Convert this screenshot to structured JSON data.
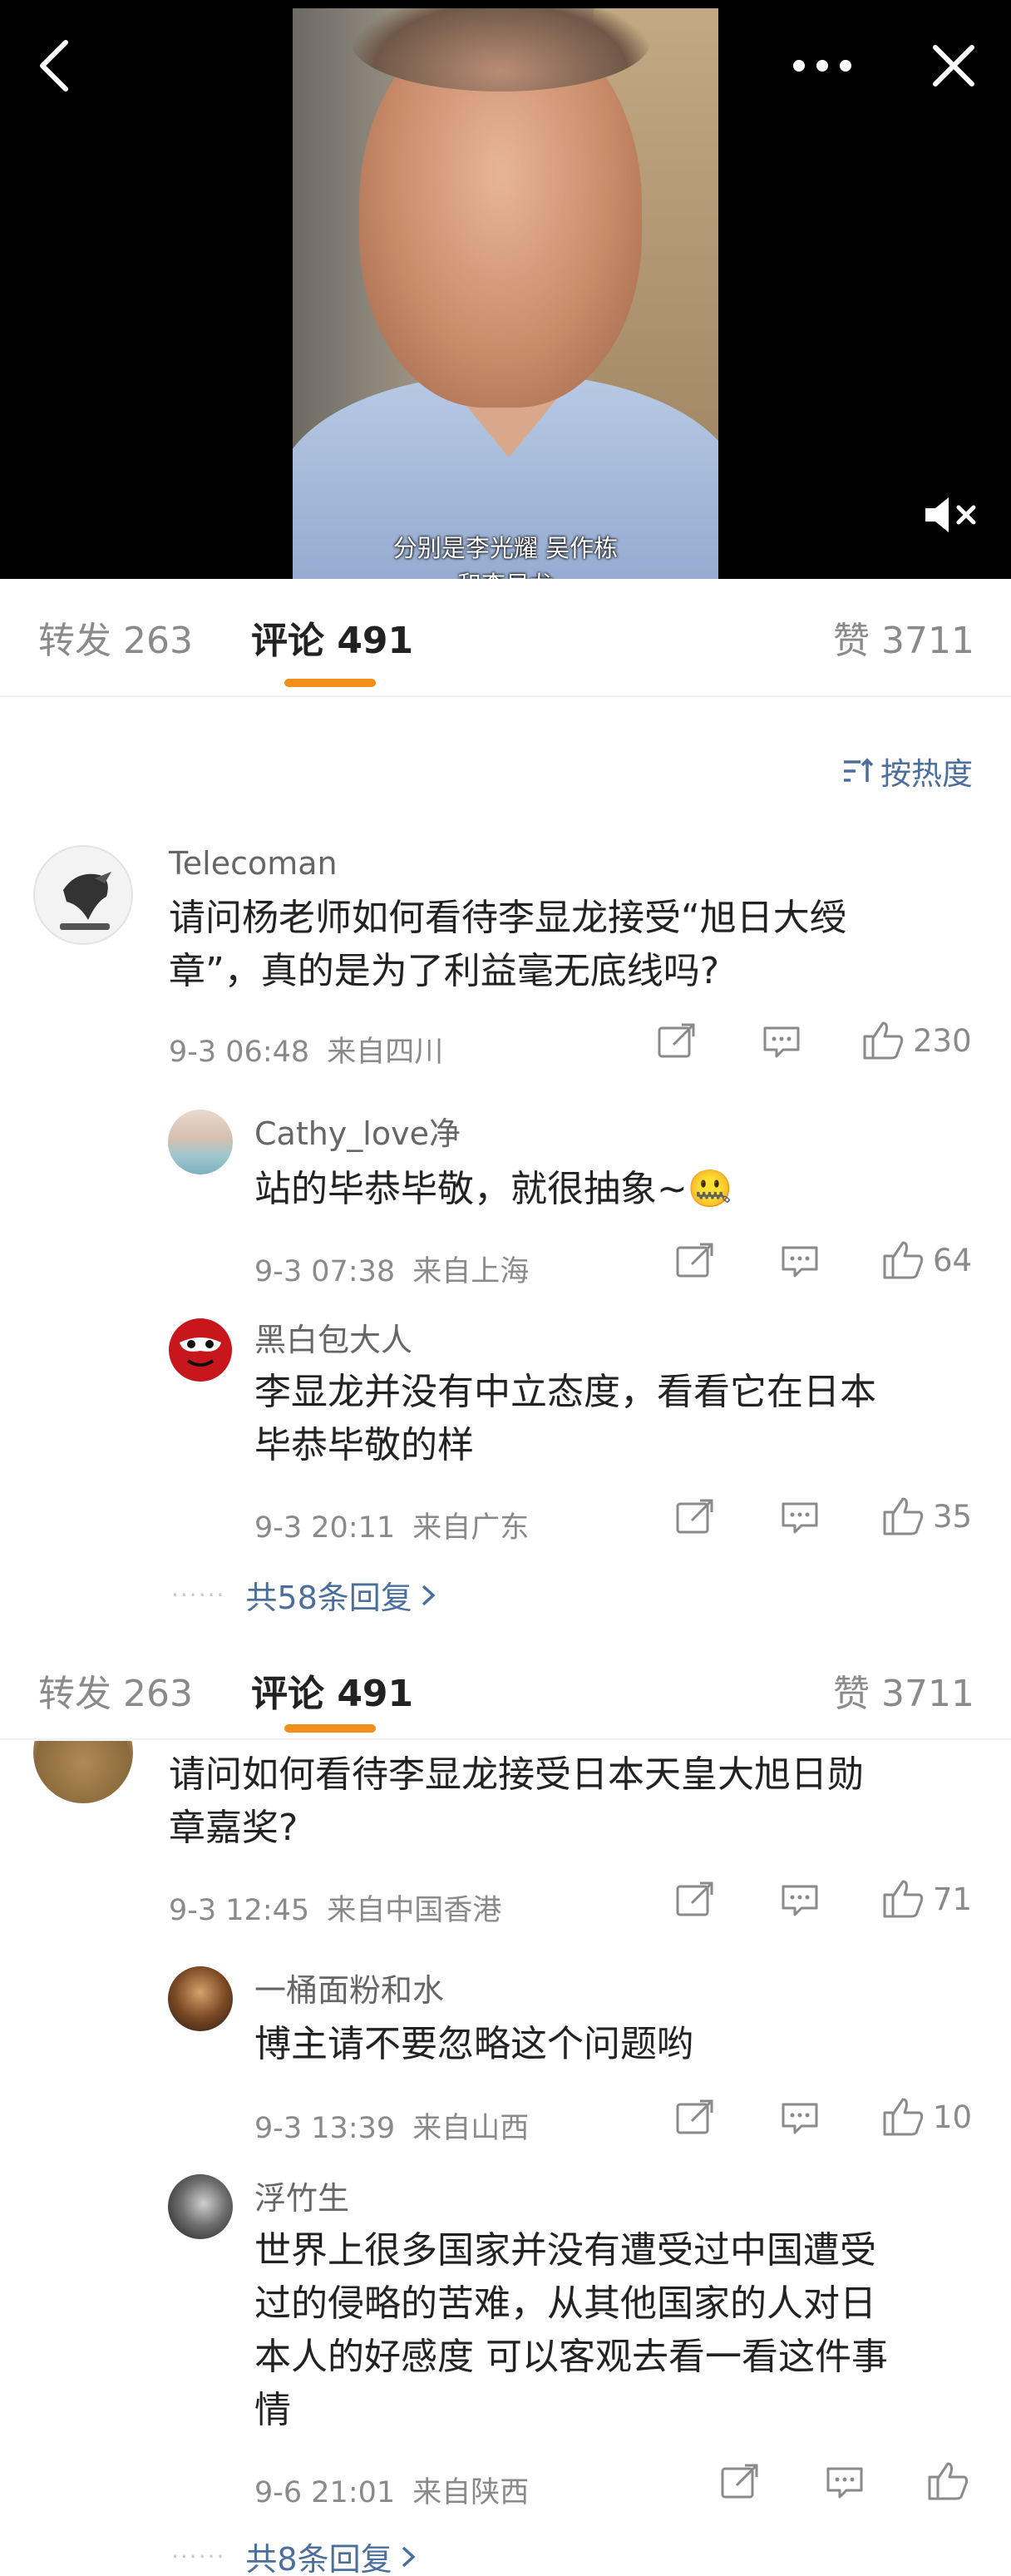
{
  "video": {
    "subtitle_line1": "分别是李光耀 吴作栋",
    "subtitle_line2": "和李显龙",
    "icons": {
      "back": "chevron-left-icon",
      "more": "more-horizontal-icon",
      "close": "close-icon",
      "mute": "speaker-muted-icon"
    }
  },
  "tabs": {
    "repost": "转发 263",
    "comment": "评论 491",
    "like": "赞 3711",
    "active_color": "#f08f1a"
  },
  "sort": {
    "label": "按热度",
    "icon": "sort-icon"
  },
  "colors": {
    "link": "#4a6f9e",
    "meta": "#8a8a8a"
  },
  "comments": [
    {
      "user": "Telecoman",
      "text_line1": "请问杨老师如何看待李显龙接受“旭日大绶",
      "text_line2": "章”，真的是为了利益毫无底线吗?",
      "time": "9-3 06:48",
      "location": "来自四川",
      "likes": "230",
      "replies_in_thread": [
        {
          "user": "Cathy_love净",
          "text": "站的毕恭毕敬，就很抽象~🤐",
          "time": "9-3 07:38",
          "location": "来自上海",
          "likes": "64"
        },
        {
          "user": "黑白包大人",
          "text_line1": "李显龙并没有中立态度，看看它在日本",
          "text_line2": "毕恭毕敬的样",
          "time": "9-3 20:11",
          "location": "来自广东",
          "likes": "35"
        }
      ],
      "more_replies": "共58条回复"
    },
    {
      "text_line1": "请问如何看待李显龙接受日本天皇大旭日勋",
      "text_line2": "章嘉奖?",
      "time": "9-3 12:45",
      "location": "来自中国香港",
      "likes": "71",
      "replies_in_thread": [
        {
          "user": "一桶面粉和水",
          "text": "博主请不要忽略这个问题哟",
          "time": "9-3 13:39",
          "location": "来自山西",
          "likes": "10"
        },
        {
          "user": "浮竹生",
          "text_line1": "世界上很多国家并没有遭受过中国遭受",
          "text_line2": "过的侵略的苦难，从其他国家的人对日",
          "text_line3": "本人的好感度 可以客观去看一看这件事",
          "text_line4": "情",
          "time": "9-6 21:01",
          "location": "来自陕西",
          "likes": ""
        }
      ],
      "more_replies": "共8条回复"
    }
  ]
}
